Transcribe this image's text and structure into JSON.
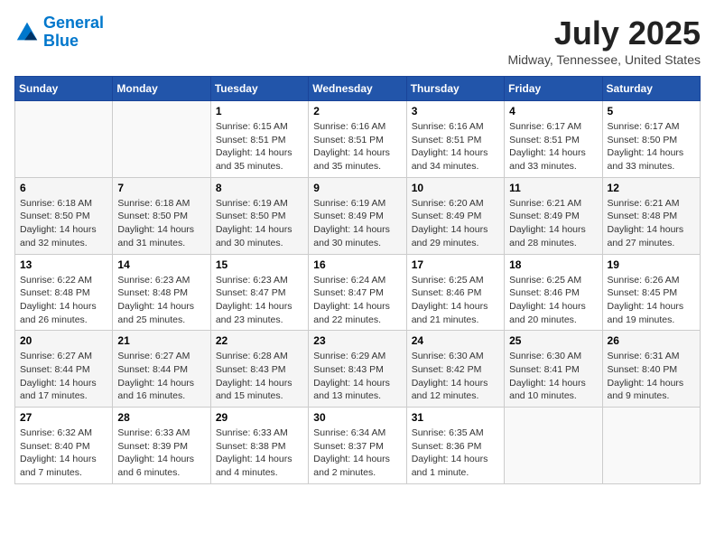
{
  "logo": {
    "line1": "General",
    "line2": "Blue"
  },
  "title": "July 2025",
  "location": "Midway, Tennessee, United States",
  "days_of_week": [
    "Sunday",
    "Monday",
    "Tuesday",
    "Wednesday",
    "Thursday",
    "Friday",
    "Saturday"
  ],
  "weeks": [
    [
      {
        "day": "",
        "sunrise": "",
        "sunset": "",
        "daylight": ""
      },
      {
        "day": "",
        "sunrise": "",
        "sunset": "",
        "daylight": ""
      },
      {
        "day": "1",
        "sunrise": "Sunrise: 6:15 AM",
        "sunset": "Sunset: 8:51 PM",
        "daylight": "Daylight: 14 hours and 35 minutes."
      },
      {
        "day": "2",
        "sunrise": "Sunrise: 6:16 AM",
        "sunset": "Sunset: 8:51 PM",
        "daylight": "Daylight: 14 hours and 35 minutes."
      },
      {
        "day": "3",
        "sunrise": "Sunrise: 6:16 AM",
        "sunset": "Sunset: 8:51 PM",
        "daylight": "Daylight: 14 hours and 34 minutes."
      },
      {
        "day": "4",
        "sunrise": "Sunrise: 6:17 AM",
        "sunset": "Sunset: 8:51 PM",
        "daylight": "Daylight: 14 hours and 33 minutes."
      },
      {
        "day": "5",
        "sunrise": "Sunrise: 6:17 AM",
        "sunset": "Sunset: 8:50 PM",
        "daylight": "Daylight: 14 hours and 33 minutes."
      }
    ],
    [
      {
        "day": "6",
        "sunrise": "Sunrise: 6:18 AM",
        "sunset": "Sunset: 8:50 PM",
        "daylight": "Daylight: 14 hours and 32 minutes."
      },
      {
        "day": "7",
        "sunrise": "Sunrise: 6:18 AM",
        "sunset": "Sunset: 8:50 PM",
        "daylight": "Daylight: 14 hours and 31 minutes."
      },
      {
        "day": "8",
        "sunrise": "Sunrise: 6:19 AM",
        "sunset": "Sunset: 8:50 PM",
        "daylight": "Daylight: 14 hours and 30 minutes."
      },
      {
        "day": "9",
        "sunrise": "Sunrise: 6:19 AM",
        "sunset": "Sunset: 8:49 PM",
        "daylight": "Daylight: 14 hours and 30 minutes."
      },
      {
        "day": "10",
        "sunrise": "Sunrise: 6:20 AM",
        "sunset": "Sunset: 8:49 PM",
        "daylight": "Daylight: 14 hours and 29 minutes."
      },
      {
        "day": "11",
        "sunrise": "Sunrise: 6:21 AM",
        "sunset": "Sunset: 8:49 PM",
        "daylight": "Daylight: 14 hours and 28 minutes."
      },
      {
        "day": "12",
        "sunrise": "Sunrise: 6:21 AM",
        "sunset": "Sunset: 8:48 PM",
        "daylight": "Daylight: 14 hours and 27 minutes."
      }
    ],
    [
      {
        "day": "13",
        "sunrise": "Sunrise: 6:22 AM",
        "sunset": "Sunset: 8:48 PM",
        "daylight": "Daylight: 14 hours and 26 minutes."
      },
      {
        "day": "14",
        "sunrise": "Sunrise: 6:23 AM",
        "sunset": "Sunset: 8:48 PM",
        "daylight": "Daylight: 14 hours and 25 minutes."
      },
      {
        "day": "15",
        "sunrise": "Sunrise: 6:23 AM",
        "sunset": "Sunset: 8:47 PM",
        "daylight": "Daylight: 14 hours and 23 minutes."
      },
      {
        "day": "16",
        "sunrise": "Sunrise: 6:24 AM",
        "sunset": "Sunset: 8:47 PM",
        "daylight": "Daylight: 14 hours and 22 minutes."
      },
      {
        "day": "17",
        "sunrise": "Sunrise: 6:25 AM",
        "sunset": "Sunset: 8:46 PM",
        "daylight": "Daylight: 14 hours and 21 minutes."
      },
      {
        "day": "18",
        "sunrise": "Sunrise: 6:25 AM",
        "sunset": "Sunset: 8:46 PM",
        "daylight": "Daylight: 14 hours and 20 minutes."
      },
      {
        "day": "19",
        "sunrise": "Sunrise: 6:26 AM",
        "sunset": "Sunset: 8:45 PM",
        "daylight": "Daylight: 14 hours and 19 minutes."
      }
    ],
    [
      {
        "day": "20",
        "sunrise": "Sunrise: 6:27 AM",
        "sunset": "Sunset: 8:44 PM",
        "daylight": "Daylight: 14 hours and 17 minutes."
      },
      {
        "day": "21",
        "sunrise": "Sunrise: 6:27 AM",
        "sunset": "Sunset: 8:44 PM",
        "daylight": "Daylight: 14 hours and 16 minutes."
      },
      {
        "day": "22",
        "sunrise": "Sunrise: 6:28 AM",
        "sunset": "Sunset: 8:43 PM",
        "daylight": "Daylight: 14 hours and 15 minutes."
      },
      {
        "day": "23",
        "sunrise": "Sunrise: 6:29 AM",
        "sunset": "Sunset: 8:43 PM",
        "daylight": "Daylight: 14 hours and 13 minutes."
      },
      {
        "day": "24",
        "sunrise": "Sunrise: 6:30 AM",
        "sunset": "Sunset: 8:42 PM",
        "daylight": "Daylight: 14 hours and 12 minutes."
      },
      {
        "day": "25",
        "sunrise": "Sunrise: 6:30 AM",
        "sunset": "Sunset: 8:41 PM",
        "daylight": "Daylight: 14 hours and 10 minutes."
      },
      {
        "day": "26",
        "sunrise": "Sunrise: 6:31 AM",
        "sunset": "Sunset: 8:40 PM",
        "daylight": "Daylight: 14 hours and 9 minutes."
      }
    ],
    [
      {
        "day": "27",
        "sunrise": "Sunrise: 6:32 AM",
        "sunset": "Sunset: 8:40 PM",
        "daylight": "Daylight: 14 hours and 7 minutes."
      },
      {
        "day": "28",
        "sunrise": "Sunrise: 6:33 AM",
        "sunset": "Sunset: 8:39 PM",
        "daylight": "Daylight: 14 hours and 6 minutes."
      },
      {
        "day": "29",
        "sunrise": "Sunrise: 6:33 AM",
        "sunset": "Sunset: 8:38 PM",
        "daylight": "Daylight: 14 hours and 4 minutes."
      },
      {
        "day": "30",
        "sunrise": "Sunrise: 6:34 AM",
        "sunset": "Sunset: 8:37 PM",
        "daylight": "Daylight: 14 hours and 2 minutes."
      },
      {
        "day": "31",
        "sunrise": "Sunrise: 6:35 AM",
        "sunset": "Sunset: 8:36 PM",
        "daylight": "Daylight: 14 hours and 1 minute."
      },
      {
        "day": "",
        "sunrise": "",
        "sunset": "",
        "daylight": ""
      },
      {
        "day": "",
        "sunrise": "",
        "sunset": "",
        "daylight": ""
      }
    ]
  ]
}
